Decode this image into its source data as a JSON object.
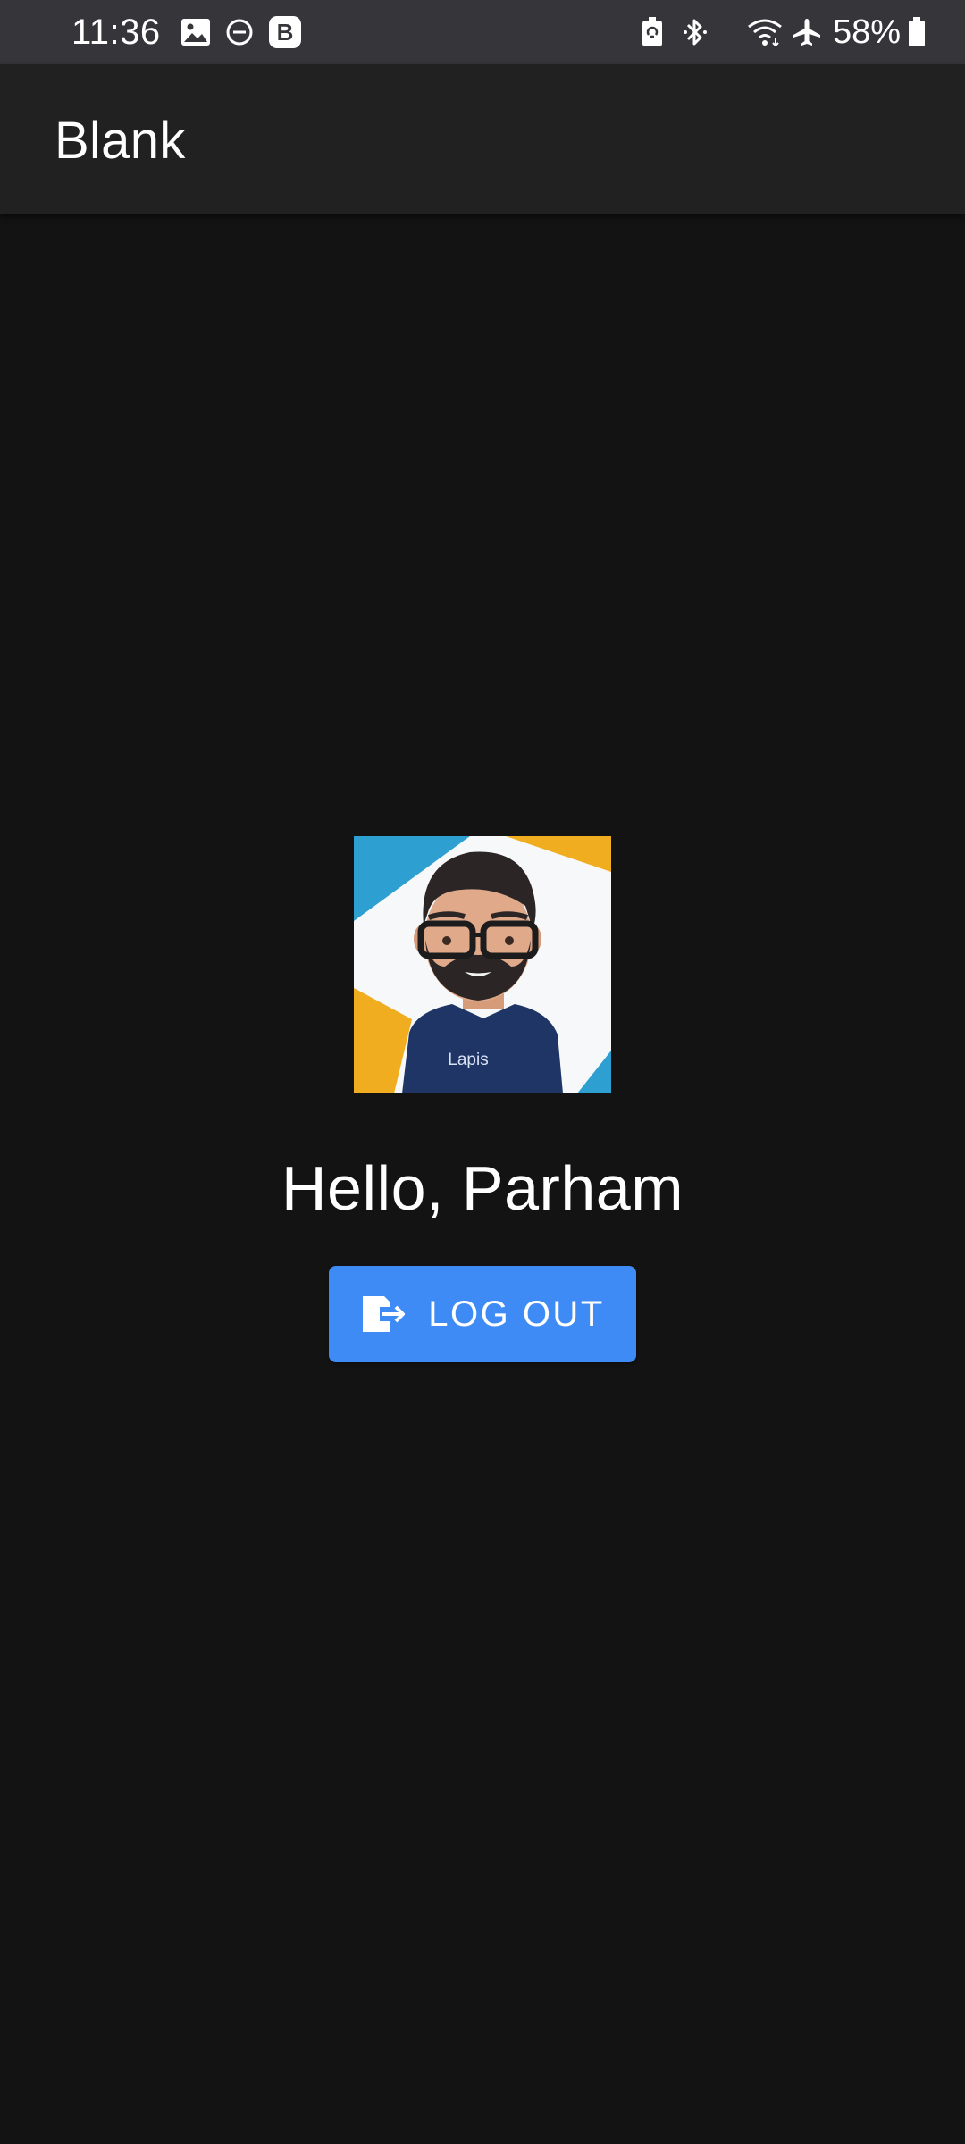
{
  "status_bar": {
    "time": "11:36",
    "battery_percent": "58%",
    "icons_left": [
      "image-icon",
      "dnd-icon",
      "b-app-icon"
    ],
    "icons_right": [
      "battery-saver-icon",
      "bluetooth-icon",
      "wifi-icon",
      "airplane-icon",
      "battery-icon"
    ]
  },
  "app_bar": {
    "title": "Blank"
  },
  "main": {
    "greeting": "Hello, Parham",
    "logout_button": {
      "label": "LOG OUT",
      "icon": "logout-icon"
    },
    "avatar": {
      "shirt_text": "Lapis"
    }
  },
  "colors": {
    "background": "#131314",
    "app_bar": "#212121",
    "status_bar": "#36353a",
    "primary": "#3f8bf5",
    "text": "#ffffff"
  }
}
